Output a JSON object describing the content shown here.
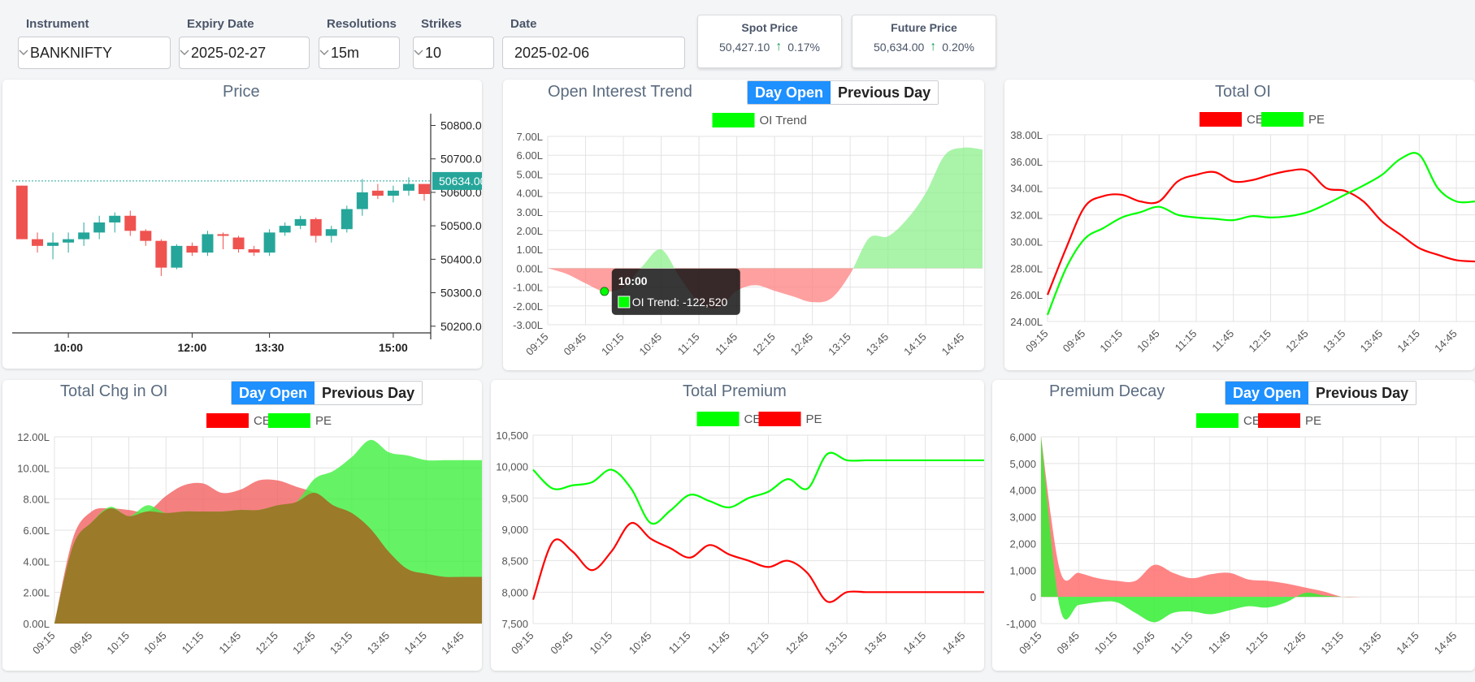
{
  "filters": {
    "instrument": {
      "label": "Instrument",
      "value": "BANKNIFTY"
    },
    "expiry": {
      "label": "Expiry Date",
      "value": "2025-02-27"
    },
    "resolution": {
      "label": "Resolutions",
      "value": "15m"
    },
    "strikes": {
      "label": "Strikes",
      "value": "10"
    },
    "date": {
      "label": "Date",
      "value": "2025-02-06"
    }
  },
  "spot": {
    "title": "Spot Price",
    "value": "50,427.10",
    "change": "0.17%"
  },
  "future": {
    "title": "Future Price",
    "value": "50,634.00",
    "change": "0.20%"
  },
  "toggle": {
    "day_open": "Day Open",
    "previous_day": "Previous Day"
  },
  "colors": {
    "ce": "#ff0000",
    "pe": "#00ff00",
    "accent": "#1e90ff",
    "bull": "#26a69a",
    "bear": "#ef5350"
  },
  "icons": {
    "select": "chevron-down-icon",
    "change": "arrow-up-icon"
  },
  "chart_data": [
    {
      "id": "price",
      "type": "candlestick",
      "title": "Price",
      "ylim": [
        50180,
        50840
      ],
      "yticks": [
        "50800.00",
        "50700.00",
        "50600.00",
        "50500.00",
        "50400.00",
        "50300.00",
        "50200.00"
      ],
      "xticks": [
        "10:00",
        "12:00",
        "13:30",
        "15:00"
      ],
      "last_price": "50634.00",
      "candles": [
        [
          50620,
          50620,
          50460,
          50460
        ],
        [
          50460,
          50480,
          50420,
          50440
        ],
        [
          50440,
          50480,
          50400,
          50450
        ],
        [
          50450,
          50480,
          50420,
          50460
        ],
        [
          50460,
          50510,
          50440,
          50480
        ],
        [
          50480,
          50530,
          50460,
          50510
        ],
        [
          50510,
          50540,
          50480,
          50530
        ],
        [
          50530,
          50545,
          50470,
          50485
        ],
        [
          50485,
          50490,
          50440,
          50455
        ],
        [
          50455,
          50460,
          50350,
          50375
        ],
        [
          50375,
          50445,
          50370,
          50440
        ],
        [
          50440,
          50450,
          50410,
          50420
        ],
        [
          50420,
          50485,
          50410,
          50475
        ],
        [
          50475,
          50480,
          50430,
          50470
        ],
        [
          50465,
          50470,
          50420,
          50430
        ],
        [
          50430,
          50440,
          50410,
          50420
        ],
        [
          50420,
          50490,
          50410,
          50480
        ],
        [
          50480,
          50510,
          50470,
          50500
        ],
        [
          50500,
          50530,
          50490,
          50520
        ],
        [
          50520,
          50525,
          50450,
          50470
        ],
        [
          50470,
          50500,
          50450,
          50490
        ],
        [
          50490,
          50560,
          50480,
          50550
        ],
        [
          50550,
          50640,
          50530,
          50600
        ],
        [
          50605,
          50625,
          50580,
          50590
        ],
        [
          50590,
          50620,
          50570,
          50605
        ],
        [
          50605,
          50645,
          50590,
          50625
        ],
        [
          50625,
          50625,
          50575,
          50595
        ]
      ]
    },
    {
      "id": "oi_trend",
      "type": "area",
      "title": "Open Interest Trend",
      "legend": [
        "OI Trend"
      ],
      "ylim": [
        -3,
        7
      ],
      "yticks": [
        "7.00L",
        "6.00L",
        "5.00L",
        "4.00L",
        "3.00L",
        "2.00L",
        "1.00L",
        "0.00L",
        "-1.00L",
        "-2.00L",
        "-3.00L"
      ],
      "x": [
        "09:15",
        "09:30",
        "09:45",
        "10:00",
        "10:15",
        "10:30",
        "10:45",
        "11:00",
        "11:15",
        "11:30",
        "11:45",
        "12:00",
        "12:15",
        "12:30",
        "12:45",
        "13:00",
        "13:15",
        "13:30",
        "13:45",
        "14:00",
        "14:15",
        "14:30",
        "14:45",
        "15:00"
      ],
      "xticks": [
        "09:15",
        "09:45",
        "10:15",
        "10:45",
        "11:15",
        "11:45",
        "12:15",
        "12:45",
        "13:15",
        "13:45",
        "14:15",
        "14:45"
      ],
      "values": [
        0,
        -0.3,
        -0.8,
        -1.23,
        -1.0,
        0.1,
        1.0,
        -0.5,
        -1.8,
        -2.1,
        -1.2,
        -0.9,
        -1.2,
        -1.5,
        -1.8,
        -1.6,
        -0.3,
        1.6,
        1.7,
        2.6,
        4.0,
        6.0,
        6.4,
        6.3
      ],
      "tooltip": {
        "time": "10:00",
        "text": "OI Trend: -122,520"
      }
    },
    {
      "id": "total_oi",
      "type": "line",
      "title": "Total OI",
      "legend": [
        "CE",
        "PE"
      ],
      "ylim": [
        24,
        38
      ],
      "yticks": [
        "38.00L",
        "36.00L",
        "34.00L",
        "32.00L",
        "30.00L",
        "28.00L",
        "26.00L",
        "24.00L"
      ],
      "x": [
        "09:15",
        "09:30",
        "09:45",
        "10:00",
        "10:15",
        "10:30",
        "10:45",
        "11:00",
        "11:15",
        "11:30",
        "11:45",
        "12:00",
        "12:15",
        "12:30",
        "12:45",
        "13:00",
        "13:15",
        "13:30",
        "13:45",
        "14:00",
        "14:15",
        "14:30",
        "14:45",
        "15:00"
      ],
      "xticks": [
        "09:15",
        "09:45",
        "10:15",
        "10:45",
        "11:15",
        "11:45",
        "12:15",
        "12:45",
        "13:15",
        "13:45",
        "14:15",
        "14:45"
      ],
      "series": [
        {
          "name": "CE",
          "values": [
            26.0,
            29.5,
            32.6,
            33.4,
            33.5,
            33.0,
            33.0,
            34.5,
            35.0,
            35.2,
            34.5,
            34.6,
            35.0,
            35.3,
            35.3,
            34.0,
            33.8,
            33.0,
            31.5,
            30.5,
            29.5,
            29.0,
            28.6,
            28.5
          ]
        },
        {
          "name": "PE",
          "values": [
            24.5,
            28.0,
            30.2,
            31.0,
            31.8,
            32.2,
            32.6,
            32.0,
            31.8,
            31.7,
            31.6,
            31.9,
            31.8,
            31.9,
            32.2,
            32.8,
            33.5,
            34.2,
            35.0,
            36.2,
            36.5,
            34.0,
            33.0,
            33.0
          ]
        }
      ]
    },
    {
      "id": "chg_oi",
      "type": "area",
      "title": "Total Chg in OI",
      "legend": [
        "CE",
        "PE"
      ],
      "ylim": [
        0,
        12
      ],
      "yticks": [
        "12.00L",
        "10.00L",
        "8.00L",
        "6.00L",
        "4.00L",
        "2.00L",
        "0.00L"
      ],
      "x": [
        "09:15",
        "09:30",
        "09:45",
        "10:00",
        "10:15",
        "10:30",
        "10:45",
        "11:00",
        "11:15",
        "11:30",
        "11:45",
        "12:00",
        "12:15",
        "12:30",
        "12:45",
        "13:00",
        "13:15",
        "13:30",
        "13:45",
        "14:00",
        "14:15",
        "14:30",
        "14:45",
        "15:00"
      ],
      "xticks": [
        "09:15",
        "09:45",
        "10:15",
        "10:45",
        "11:15",
        "11:45",
        "12:15",
        "12:45",
        "13:15",
        "13:45",
        "14:15",
        "14:45"
      ],
      "series": [
        {
          "name": "CE",
          "values": [
            0,
            5.5,
            7.2,
            7.4,
            7.3,
            7.2,
            8.2,
            8.9,
            9.0,
            8.4,
            8.6,
            9.2,
            9.2,
            8.8,
            8.4,
            7.6,
            7.1,
            6.1,
            4.6,
            3.5,
            3.2,
            3.0,
            3.0,
            3.0
          ]
        },
        {
          "name": "PE",
          "values": [
            0,
            5.0,
            6.5,
            7.5,
            6.9,
            7.6,
            7.1,
            7.2,
            7.2,
            7.2,
            7.3,
            7.3,
            7.6,
            7.8,
            9.3,
            9.8,
            10.7,
            11.8,
            11.0,
            10.8,
            10.5,
            10.5,
            10.5,
            10.5
          ]
        }
      ]
    },
    {
      "id": "total_premium",
      "type": "line",
      "title": "Total Premium",
      "legend": [
        "CE",
        "PE"
      ],
      "ylim": [
        7500,
        10500
      ],
      "yticks": [
        "10,500",
        "10,000",
        "9,500",
        "9,000",
        "8,500",
        "8,000",
        "7,500"
      ],
      "x": [
        "09:15",
        "09:30",
        "09:45",
        "10:00",
        "10:15",
        "10:30",
        "10:45",
        "11:00",
        "11:15",
        "11:30",
        "11:45",
        "12:00",
        "12:15",
        "12:30",
        "12:45",
        "13:00",
        "13:15",
        "13:30",
        "13:45",
        "14:00",
        "14:15",
        "14:30",
        "14:45",
        "15:00"
      ],
      "xticks": [
        "09:15",
        "09:45",
        "10:15",
        "10:45",
        "11:15",
        "11:45",
        "12:15",
        "12:45",
        "13:15",
        "13:45",
        "14:15",
        "14:45"
      ],
      "series": [
        {
          "name": "CE",
          "values": [
            9950,
            9650,
            9700,
            9750,
            9950,
            9650,
            9100,
            9300,
            9550,
            9450,
            9350,
            9500,
            9600,
            9800,
            9650,
            10200,
            10100,
            10100,
            10100,
            10100,
            10100,
            10100,
            10100,
            10100
          ]
        },
        {
          "name": "PE",
          "values": [
            7880,
            8800,
            8650,
            8350,
            8650,
            9100,
            8850,
            8700,
            8550,
            8750,
            8600,
            8500,
            8400,
            8500,
            8300,
            7850,
            8000,
            8000,
            8000,
            8000,
            8000,
            8000,
            8000,
            8000
          ]
        }
      ]
    },
    {
      "id": "premium_decay",
      "type": "area",
      "title": "Premium Decay",
      "legend": [
        "CE",
        "PE"
      ],
      "ylim": [
        -1000,
        6000
      ],
      "yticks": [
        "6,000",
        "5,000",
        "4,000",
        "3,000",
        "2,000",
        "1,000",
        "0",
        "-1,000"
      ],
      "x": [
        "09:15",
        "09:30",
        "09:45",
        "10:00",
        "10:15",
        "10:30",
        "10:45",
        "11:00",
        "11:15",
        "11:30",
        "11:45",
        "12:00",
        "12:15",
        "12:30",
        "12:45",
        "13:00",
        "13:15",
        "13:30",
        "13:45",
        "14:00",
        "14:15",
        "14:30",
        "14:45",
        "15:00"
      ],
      "xticks": [
        "09:15",
        "09:45",
        "10:15",
        "10:45",
        "11:15",
        "11:45",
        "12:15",
        "12:45",
        "13:15",
        "13:45",
        "14:15",
        "14:45"
      ],
      "series": [
        {
          "name": "CE",
          "values": [
            6000,
            1000,
            900,
            700,
            600,
            600,
            1200,
            900,
            700,
            850,
            900,
            650,
            600,
            500,
            350,
            200,
            0,
            0,
            0,
            0,
            0,
            0,
            0,
            0
          ]
        },
        {
          "name": "PE",
          "values": [
            6000,
            -400,
            -300,
            -200,
            -200,
            -600,
            -950,
            -600,
            -550,
            -650,
            -500,
            -350,
            -400,
            -200,
            150,
            50,
            0,
            0,
            0,
            0,
            0,
            0,
            0,
            0
          ]
        }
      ]
    }
  ]
}
